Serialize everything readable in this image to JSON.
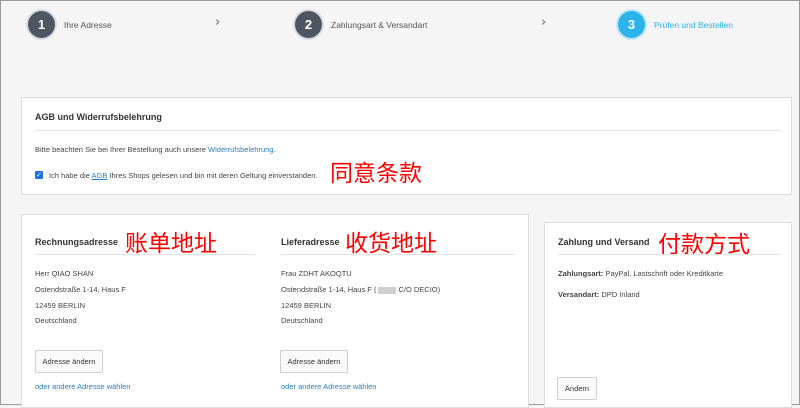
{
  "steps": [
    {
      "num": "1",
      "label": "Ihre Adresse"
    },
    {
      "num": "2",
      "label": "Zahlungsart & Versandart"
    },
    {
      "num": "3",
      "label": "Prüfen und Bestellen"
    }
  ],
  "chevron": "›",
  "agb": {
    "title": "AGB und Widerrufsbelehrung",
    "notice_prefix": "Bitte beachten Sie bei Ihrer Bestellung auch unsere ",
    "notice_link": "Widerrufsbelehrung",
    "notice_suffix": ".",
    "checkbox_prefix": "Ich habe die ",
    "checkbox_link": "AGB",
    "checkbox_suffix": " Ihres Shops gelesen und bin mit deren Geltung einverstanden.",
    "checked": true
  },
  "annotations": {
    "agree": "同意条款",
    "billing": "账单地址",
    "shipping": "收货地址",
    "payment": "付款方式"
  },
  "billing": {
    "title": "Rechnungsadresse",
    "lines": [
      "Herr QIAO SHAN",
      "Ostendstraße 1-14, Haus F",
      "12459 BERLIN",
      "Deutschland"
    ],
    "change_button": "Adresse ändern",
    "other_link": "oder andere Adresse wählen"
  },
  "shipping": {
    "title": "Lieferadresse",
    "lines": [
      "Frau ZDHT AKOQTU",
      "Ostendstraße 1-14, Haus F (",
      "C/O DECIO)",
      "12459 BERLIN",
      "Deutschland"
    ],
    "change_button": "Adresse ändern",
    "other_link": "oder andere Adresse wählen"
  },
  "payment": {
    "title": "Zahlung und Versand",
    "payment_label": "Zahlungsart:",
    "payment_value": " PayPal, Lastschrift oder Kreditkarte",
    "shipping_label": "Versandart:",
    "shipping_value": " DPD Inland",
    "change_button": "Ändern"
  }
}
